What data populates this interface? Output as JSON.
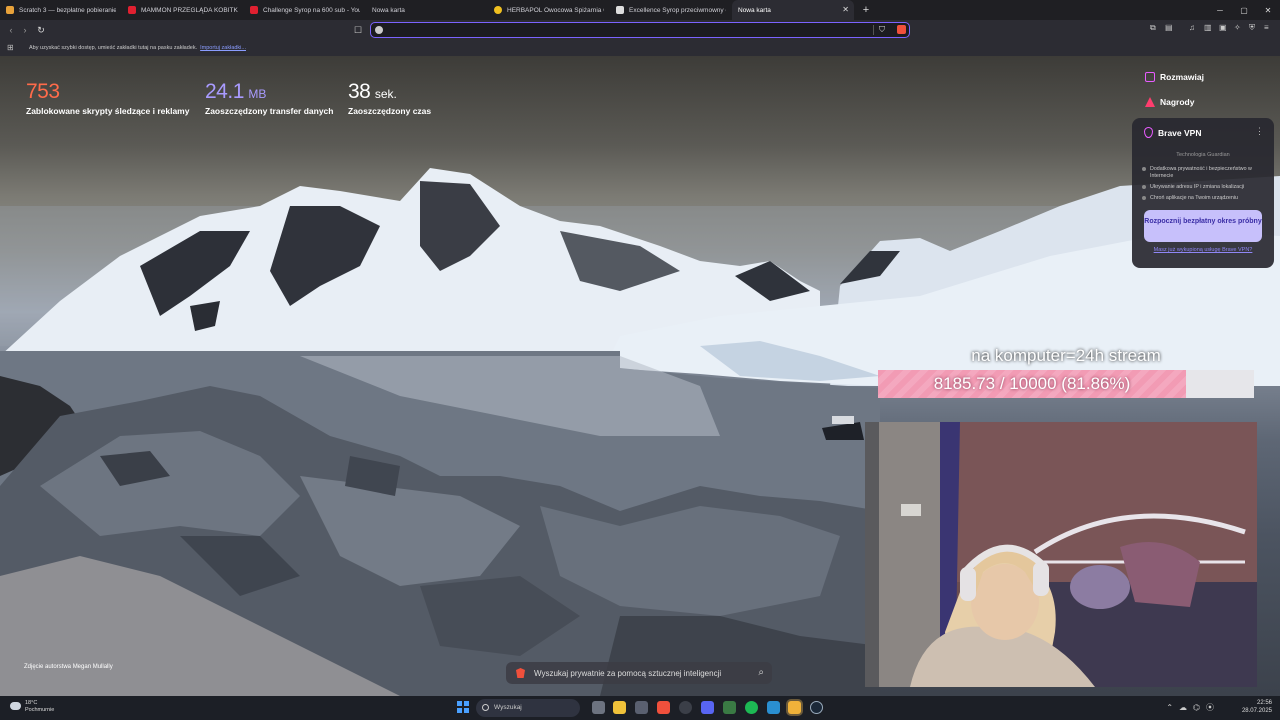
{
  "tabs": [
    {
      "label": "Scratch 3 — bezpłatne pobieranie i i",
      "color": "#e8a23a"
    },
    {
      "label": "MAMMON PRZEGLĄDA KOBITKI | M",
      "color": "#e02030"
    },
    {
      "label": "Challenge Syrop na 600 sub - YouTu",
      "color": "#e02030"
    },
    {
      "label": "Nowa karta",
      "color": ""
    },
    {
      "label": "HERBAPOL Owocowa Spiżarnia Czar",
      "color": "#f0c020"
    },
    {
      "label": "Excellence Syrop przeciwmowny o sm",
      "color": "#dddddd"
    },
    {
      "label": "Nowa karta",
      "color": "",
      "active": true,
      "close": "✕"
    }
  ],
  "newtab_label": "+",
  "window_controls": {
    "minimize": "─",
    "restore": "▢",
    "close": "✕"
  },
  "urlbar": {
    "value": "",
    "placeholder": ""
  },
  "bookmarks": {
    "message": "Aby uzyskać szybki dostęp, umieść zakładki tutaj na pasku zakładek.",
    "import_link": "Importuj zakładki..."
  },
  "stats": [
    {
      "value": "753",
      "unit": "",
      "label": "Zablokowane skrypty śledzące i reklamy",
      "color": "#ff6b4a"
    },
    {
      "value": "24.1",
      "unit": "MB",
      "label": "Zaoszczędzony transfer danych",
      "color": "#a99bff"
    },
    {
      "value": "38",
      "unit": "sek.",
      "label": "Zaoszczędzony czas",
      "color": "#ffffff"
    }
  ],
  "right_panel": {
    "talk": "Rozmawiaj",
    "rewards": "Nagrody",
    "vpn": {
      "title": "Brave VPN",
      "more": "⋮",
      "tech": "Technologia  Guardian",
      "features": [
        "Dodatkowa prywatność i bezpieczeństwo w Internecie",
        "Ukrywanie adresu IP i zmiana lokalizacji",
        "Chroń aplikacje na Twoim urządzeniu"
      ],
      "cta": "Rozpocznij bezpłatny okres próbny",
      "have": "Masz już wykupioną usługę Brave VPN?"
    }
  },
  "overlay": {
    "title": "na komputer=24h stream",
    "progress_text": "8185.73 / 10000 (81.86%)",
    "progress_fraction": 0.8186
  },
  "photo_credit": "Zdjęcie autorstwa Megan Mullally",
  "ai_search": {
    "text": "Wyszukaj prywatnie za pomocą sztucznej inteligencji",
    "icon": "search-icon"
  },
  "taskbar": {
    "weather_temp": "18°C",
    "weather_desc": "Pochmurnie",
    "search": "Wyszukaj",
    "time": "22:56",
    "date": "28.07.2025"
  }
}
